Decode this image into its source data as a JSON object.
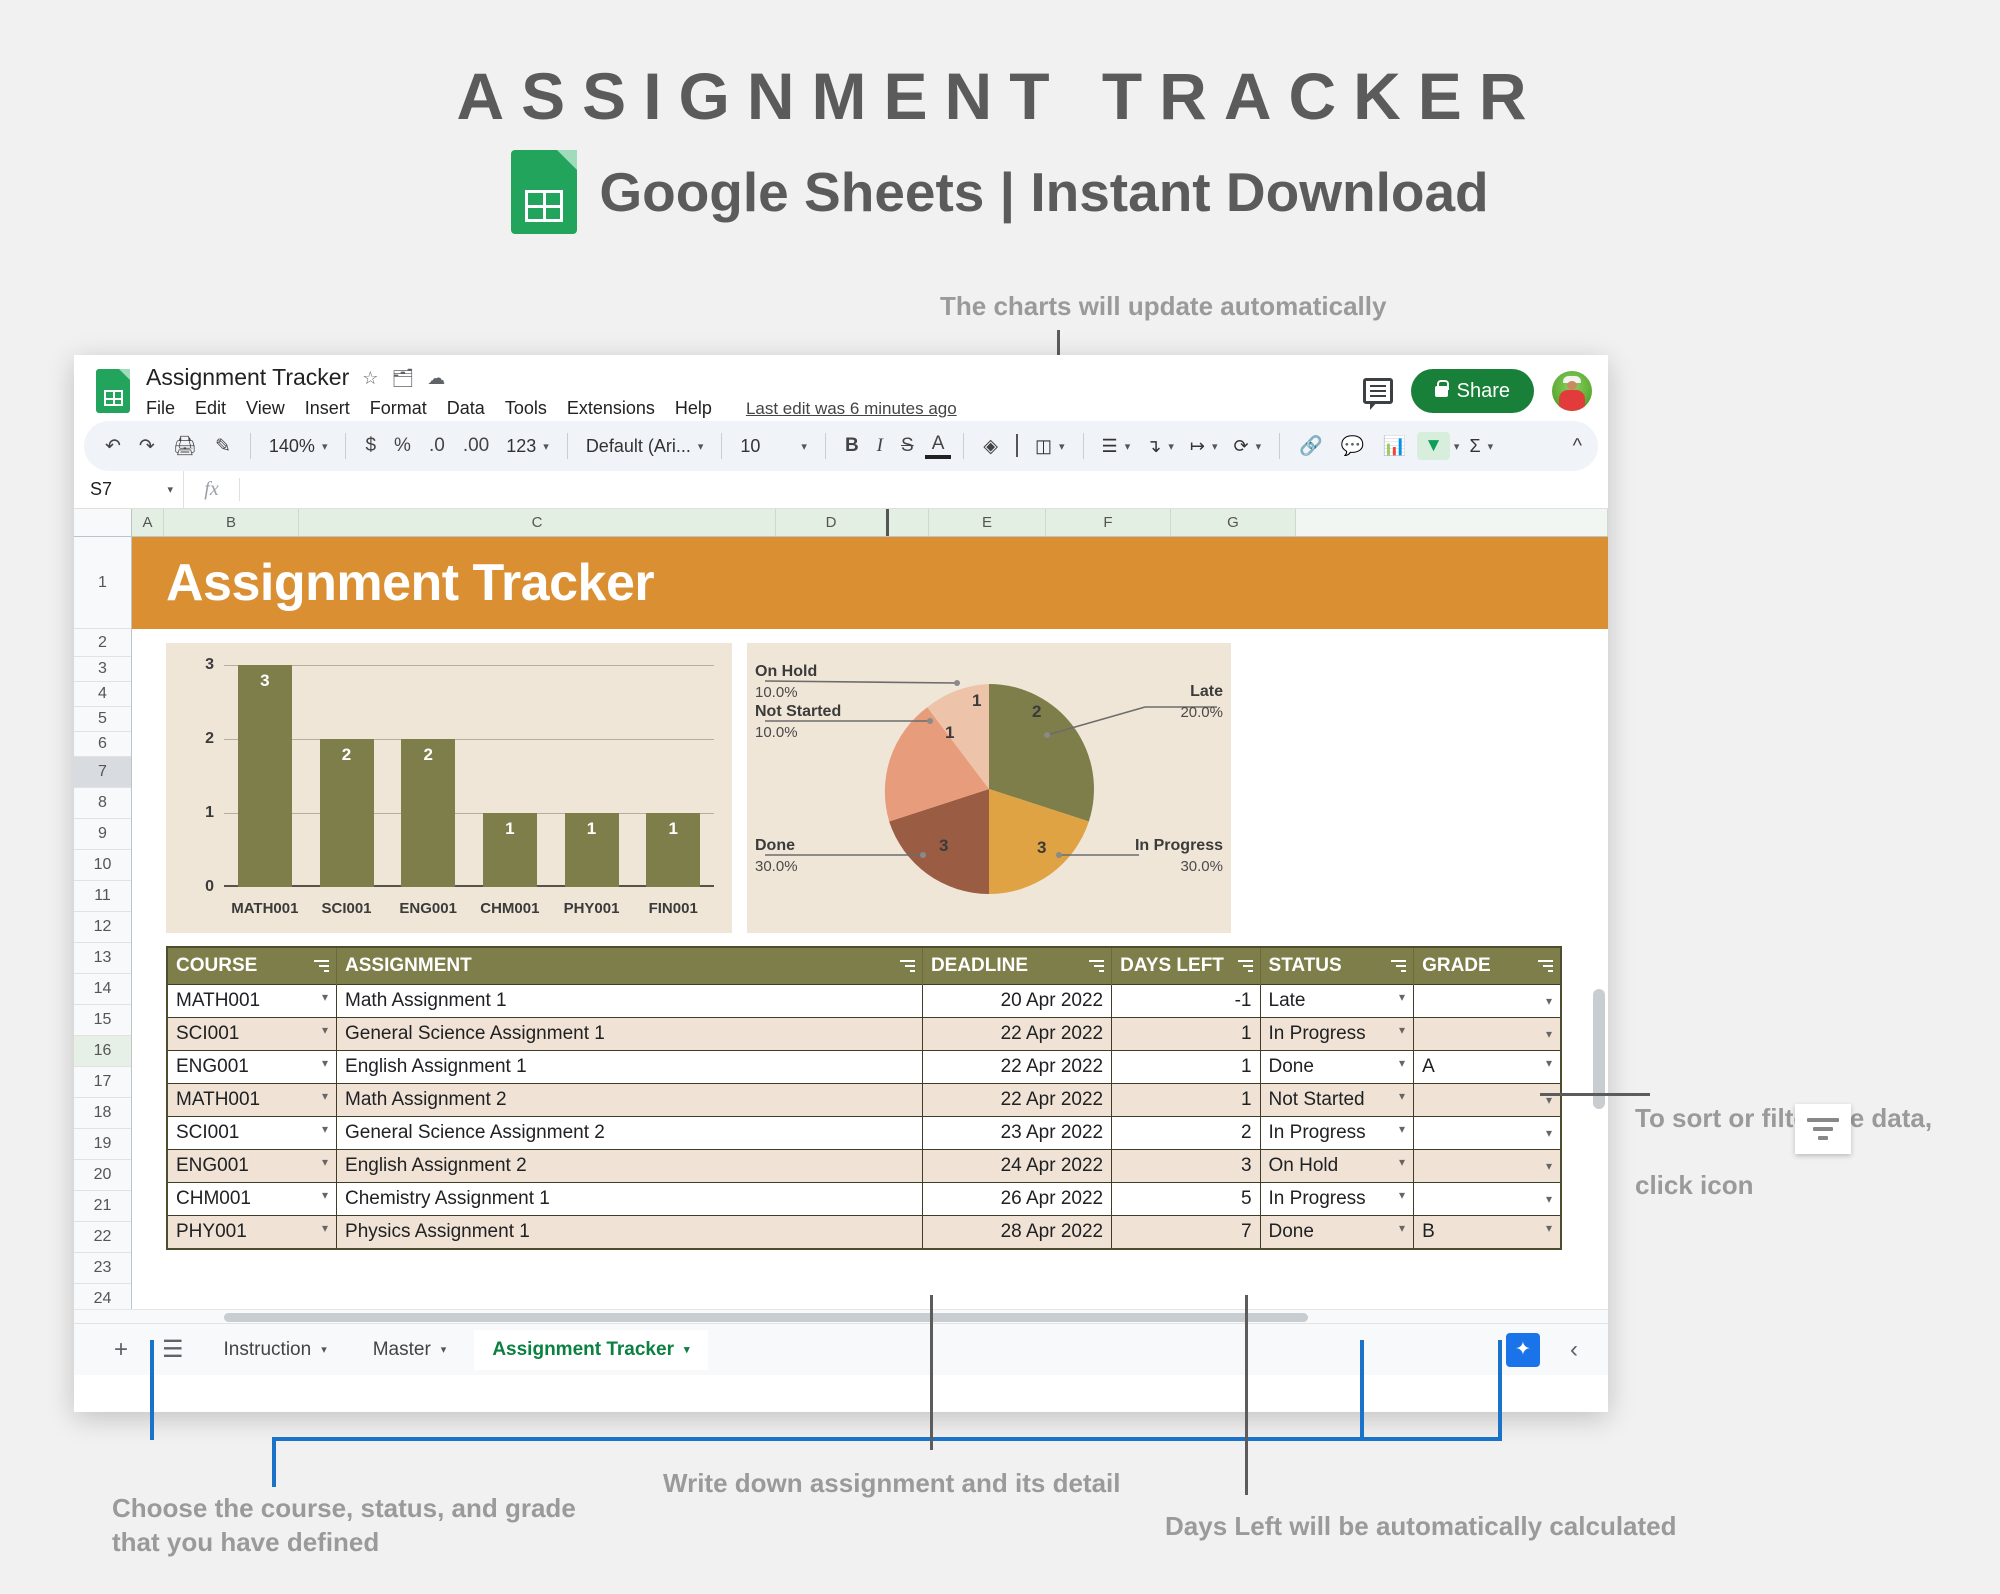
{
  "promo": {
    "title": "ASSIGNMENT TRACKER",
    "subtitle": "Google Sheets | Instant Download"
  },
  "annotations": {
    "charts": "The charts will update automatically",
    "sort_filter_line1": "To sort or filter the data,",
    "sort_filter_line2": "click icon",
    "choose": "Choose the course, status, and grade\nthat you have defined",
    "write_down": "Write down assignment and its detail",
    "days_left": "Days Left will be automatically calculated"
  },
  "app": {
    "doc_title": "Assignment Tracker",
    "last_edit": "Last edit was 6 minutes ago",
    "menus": [
      "File",
      "Edit",
      "View",
      "Insert",
      "Format",
      "Data",
      "Tools",
      "Extensions",
      "Help"
    ],
    "share_label": "Share",
    "toolbar": {
      "zoom": "140%",
      "currency": "$",
      "percent": "%",
      "dec_less": ".0",
      "dec_more": ".00",
      "formats": "123",
      "font": "Default (Ari...",
      "font_size": "10",
      "bold": "B",
      "italic": "I",
      "strike": "S",
      "text_color": "A",
      "sigma": "Σ"
    },
    "name_box": "S7",
    "formula": "",
    "columns": [
      "A",
      "B",
      "C",
      "D",
      "E",
      "F",
      "G"
    ],
    "rows": [
      "1",
      "2",
      "3",
      "4",
      "5",
      "6",
      "7",
      "8",
      "9",
      "10",
      "11",
      "12",
      "13",
      "14",
      "15",
      "16",
      "17",
      "18",
      "19",
      "20",
      "21",
      "22",
      "23",
      "24"
    ],
    "selected_row": "7",
    "sheet_tabs": [
      {
        "label": "Instruction",
        "active": false
      },
      {
        "label": "Master",
        "active": false
      },
      {
        "label": "Assignment Tracker",
        "active": true
      }
    ]
  },
  "sheet": {
    "banner_title": "Assignment Tracker",
    "table": {
      "headers": [
        "COURSE",
        "ASSIGNMENT",
        "DEADLINE",
        "DAYS LEFT",
        "STATUS",
        "GRADE"
      ],
      "rows": [
        {
          "course": "MATH001",
          "assignment": "Math Assignment 1",
          "deadline": "20 Apr 2022",
          "days_left": "-1",
          "status": "Late",
          "grade": ""
        },
        {
          "course": "SCI001",
          "assignment": "General Science Assignment 1",
          "deadline": "22 Apr 2022",
          "days_left": "1",
          "status": "In Progress",
          "grade": ""
        },
        {
          "course": "ENG001",
          "assignment": "English Assignment 1",
          "deadline": "22 Apr 2022",
          "days_left": "1",
          "status": "Done",
          "grade": "A"
        },
        {
          "course": "MATH001",
          "assignment": "Math Assignment 2",
          "deadline": "22 Apr 2022",
          "days_left": "1",
          "status": "Not Started",
          "grade": ""
        },
        {
          "course": "SCI001",
          "assignment": "General Science Assignment 2",
          "deadline": "23 Apr 2022",
          "days_left": "2",
          "status": "In Progress",
          "grade": ""
        },
        {
          "course": "ENG001",
          "assignment": "English Assignment 2",
          "deadline": "24 Apr 2022",
          "days_left": "3",
          "status": "On Hold",
          "grade": ""
        },
        {
          "course": "CHM001",
          "assignment": "Chemistry Assignment 1",
          "deadline": "26 Apr 2022",
          "days_left": "5",
          "status": "In Progress",
          "grade": ""
        },
        {
          "course": "PHY001",
          "assignment": "Physics Assignment 1",
          "deadline": "28 Apr 2022",
          "days_left": "7",
          "status": "Done",
          "grade": "B"
        }
      ]
    }
  },
  "chart_data": [
    {
      "type": "bar",
      "title": "",
      "categories": [
        "MATH001",
        "SCI001",
        "ENG001",
        "CHM001",
        "PHY001",
        "FIN001"
      ],
      "values": [
        3,
        2,
        2,
        1,
        1,
        1
      ],
      "xlabel": "",
      "ylabel": "",
      "ylim": [
        0,
        3
      ],
      "yticks": [
        0,
        1,
        2,
        3
      ],
      "grid": true,
      "bar_color": "#7e7e4a",
      "plot_bg": "#f0e6d8"
    },
    {
      "type": "pie",
      "title": "",
      "labels": [
        "Late",
        "In Progress",
        "Done",
        "Not Started",
        "On Hold"
      ],
      "values": [
        2,
        3,
        3,
        1,
        1
      ],
      "percents": [
        "20.0%",
        "30.0%",
        "30.0%",
        "10.0%",
        "10.0%"
      ],
      "colors": [
        "#7e7e4a",
        "#dfa343",
        "#9a5c43",
        "#e79d7c",
        "#edc3aa"
      ],
      "legend": "callout-labels",
      "plot_bg": "#f0e6d8"
    }
  ],
  "colors": {
    "banner": "#db8f33",
    "table_header": "#7e7e4a",
    "row_alt": "#f0e3d5",
    "accent_blue": "#1a73c8",
    "anno_gray": "#9a9a9a"
  }
}
